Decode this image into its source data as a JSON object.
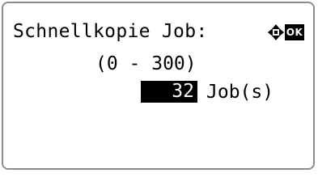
{
  "screen": {
    "title": "Schnellkopie Job:",
    "nav_icon": "four-way-arrow-icon",
    "ok_label": "OK",
    "range_text": "(0 - 300)",
    "value": "32",
    "unit": "Job(s)"
  },
  "colors": {
    "background": "#ffffff",
    "text": "#000000",
    "highlight": "#000000",
    "border": "#8c8c8c"
  }
}
